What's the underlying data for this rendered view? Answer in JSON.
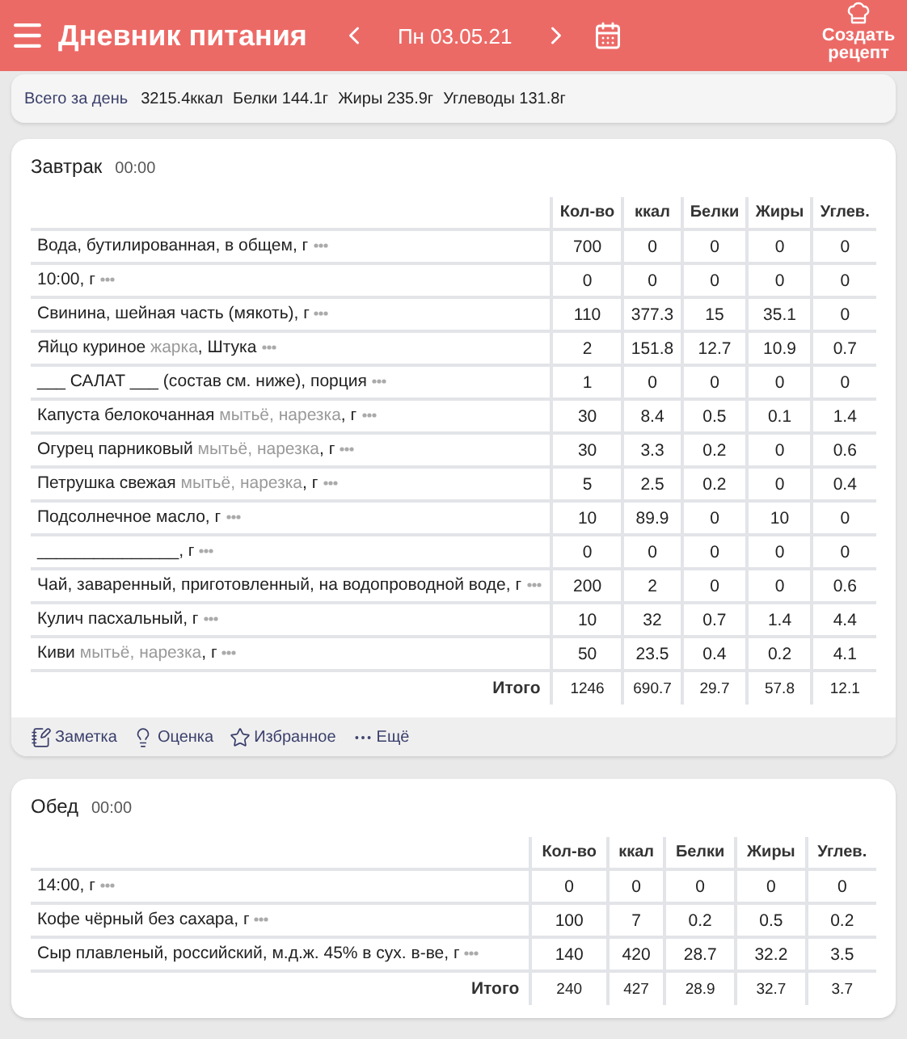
{
  "header": {
    "title": "Дневник питания",
    "date": "Пн 03.05.21",
    "create_button": "Создать рецепт"
  },
  "day_summary": {
    "label": "Всего за день",
    "kcal": "3215.4ккал",
    "protein": "Белки 144.1г",
    "fat": "Жиры 235.9г",
    "carbs": "Углеводы 131.8г"
  },
  "meals": [
    {
      "title": "Завтрак",
      "time": "00:00",
      "columns": [
        "Кол-во",
        "ккал",
        "Белки",
        "Жиры",
        "Углев."
      ],
      "rows": [
        {
          "parts": [
            {
              "text": "Вода, бутилированная, в общем, г",
              "muted": false
            }
          ],
          "values": [
            "700",
            "0",
            "0",
            "0",
            "0"
          ]
        },
        {
          "parts": [
            {
              "text": "10:00, г",
              "muted": false
            }
          ],
          "values": [
            "0",
            "0",
            "0",
            "0",
            "0"
          ]
        },
        {
          "parts": [
            {
              "text": "Свинина, шейная часть (мякоть), г",
              "muted": false
            }
          ],
          "values": [
            "110",
            "377.3",
            "15",
            "35.1",
            "0"
          ]
        },
        {
          "parts": [
            {
              "text": "Яйцо куриное ",
              "muted": false
            },
            {
              "text": "жарка",
              "muted": true
            },
            {
              "text": ", Штука",
              "muted": false
            }
          ],
          "values": [
            "2",
            "151.8",
            "12.7",
            "10.9",
            "0.7"
          ]
        },
        {
          "parts": [
            {
              "text": "___ САЛАТ ___ (состав см. ниже), порция",
              "muted": false
            }
          ],
          "values": [
            "1",
            "0",
            "0",
            "0",
            "0"
          ]
        },
        {
          "parts": [
            {
              "text": "Капуста белокочанная ",
              "muted": false
            },
            {
              "text": "мытьё, нарезка",
              "muted": true
            },
            {
              "text": ", г",
              "muted": false
            }
          ],
          "values": [
            "30",
            "8.4",
            "0.5",
            "0.1",
            "1.4"
          ]
        },
        {
          "parts": [
            {
              "text": "Огурец парниковый ",
              "muted": false
            },
            {
              "text": "мытьё, нарезка",
              "muted": true
            },
            {
              "text": ", г",
              "muted": false
            }
          ],
          "values": [
            "30",
            "3.3",
            "0.2",
            "0",
            "0.6"
          ]
        },
        {
          "parts": [
            {
              "text": "Петрушка свежая ",
              "muted": false
            },
            {
              "text": "мытьё, нарезка",
              "muted": true
            },
            {
              "text": ", г",
              "muted": false
            }
          ],
          "values": [
            "5",
            "2.5",
            "0.2",
            "0",
            "0.4"
          ]
        },
        {
          "parts": [
            {
              "text": "Подсолнечное масло, г",
              "muted": false
            }
          ],
          "values": [
            "10",
            "89.9",
            "0",
            "10",
            "0"
          ]
        },
        {
          "parts": [
            {
              "text": "_______________, г",
              "muted": false
            }
          ],
          "values": [
            "0",
            "0",
            "0",
            "0",
            "0"
          ]
        },
        {
          "parts": [
            {
              "text": "Чай, заваренный, приготовленный, на водопроводной воде, г",
              "muted": false
            }
          ],
          "values": [
            "200",
            "2",
            "0",
            "0",
            "0.6"
          ]
        },
        {
          "parts": [
            {
              "text": "Кулич пасхальный, г",
              "muted": false
            }
          ],
          "values": [
            "10",
            "32",
            "0.7",
            "1.4",
            "4.4"
          ]
        },
        {
          "parts": [
            {
              "text": "Киви ",
              "muted": false
            },
            {
              "text": "мытьё, нарезка",
              "muted": true
            },
            {
              "text": ", г",
              "muted": false
            }
          ],
          "values": [
            "50",
            "23.5",
            "0.4",
            "0.2",
            "4.1"
          ]
        }
      ],
      "total_label": "Итого",
      "totals": [
        "1246",
        "690.7",
        "29.7",
        "57.8",
        "12.1"
      ],
      "actions": [
        {
          "kind": "note",
          "label": "Заметка"
        },
        {
          "kind": "rating",
          "label": "Оценка"
        },
        {
          "kind": "favorite",
          "label": "Избранное"
        },
        {
          "kind": "more",
          "label": "Ещё"
        }
      ]
    },
    {
      "title": "Обед",
      "time": "00:00",
      "columns": [
        "Кол-во",
        "ккал",
        "Белки",
        "Жиры",
        "Углев."
      ],
      "rows": [
        {
          "parts": [
            {
              "text": "14:00, г",
              "muted": false
            }
          ],
          "values": [
            "0",
            "0",
            "0",
            "0",
            "0"
          ]
        },
        {
          "parts": [
            {
              "text": "Кофе чёрный без сахара, г",
              "muted": false
            }
          ],
          "values": [
            "100",
            "7",
            "0.2",
            "0.5",
            "0.2"
          ]
        },
        {
          "parts": [
            {
              "text": "Сыр плавленый, российский, м.д.ж. 45% в сух. в-ве, г",
              "muted": false
            }
          ],
          "values": [
            "140",
            "420",
            "28.7",
            "32.2",
            "3.5"
          ]
        }
      ],
      "total_label": "Итого",
      "totals": [
        "240",
        "427",
        "28.9",
        "32.7",
        "3.7"
      ]
    }
  ]
}
